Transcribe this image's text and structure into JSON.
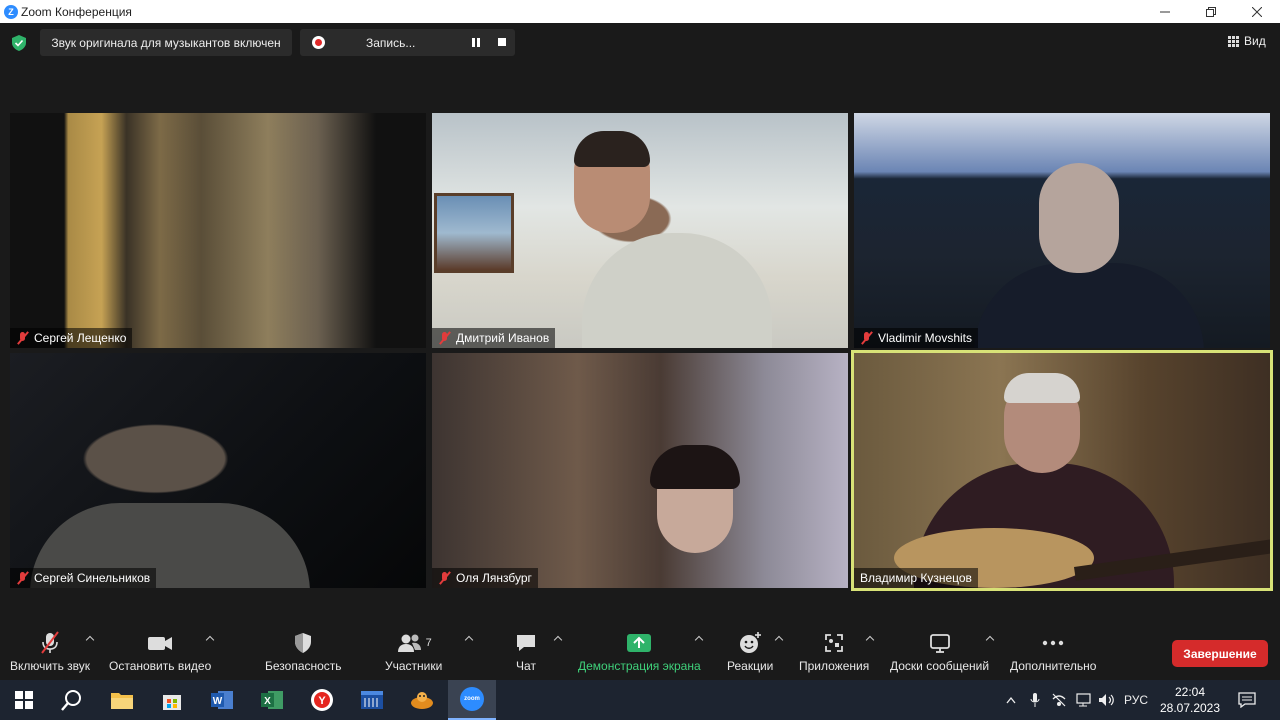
{
  "window": {
    "title": "Zoom Конференция"
  },
  "topbar": {
    "audio_status": "Звук оригинала для музыкантов включен",
    "recording_label": "Запись...",
    "view_label": "Вид"
  },
  "participants": [
    {
      "name": "Сергей Лещенко",
      "muted": true
    },
    {
      "name": "Дмитрий Иванов",
      "muted": true
    },
    {
      "name": "Vladimir Movshits",
      "muted": true
    },
    {
      "name": "Сергей Синельников",
      "muted": true
    },
    {
      "name": "Оля Лянзбург",
      "muted": true
    },
    {
      "name": "Владимир Кузнецов",
      "muted": false,
      "active_speaker": true
    }
  ],
  "toolbar": {
    "unmute": "Включить звук",
    "stop_video": "Остановить видео",
    "security": "Безопасность",
    "participants": "Участники",
    "participants_count": "7",
    "chat": "Чат",
    "share_screen": "Демонстрация экрана",
    "reactions": "Реакции",
    "apps": "Приложения",
    "whiteboards": "Доски сообщений",
    "more": "Дополнительно",
    "end": "Завершение"
  },
  "taskbar": {
    "language": "РУС",
    "time": "22:04",
    "date": "28.07.2023",
    "zoom_icon_label": "zoom"
  },
  "colors": {
    "active_speaker_border": "#d8e277",
    "share_green": "#3fd07a",
    "end_red": "#d52b2b",
    "muted_red": "#e23c3c"
  }
}
